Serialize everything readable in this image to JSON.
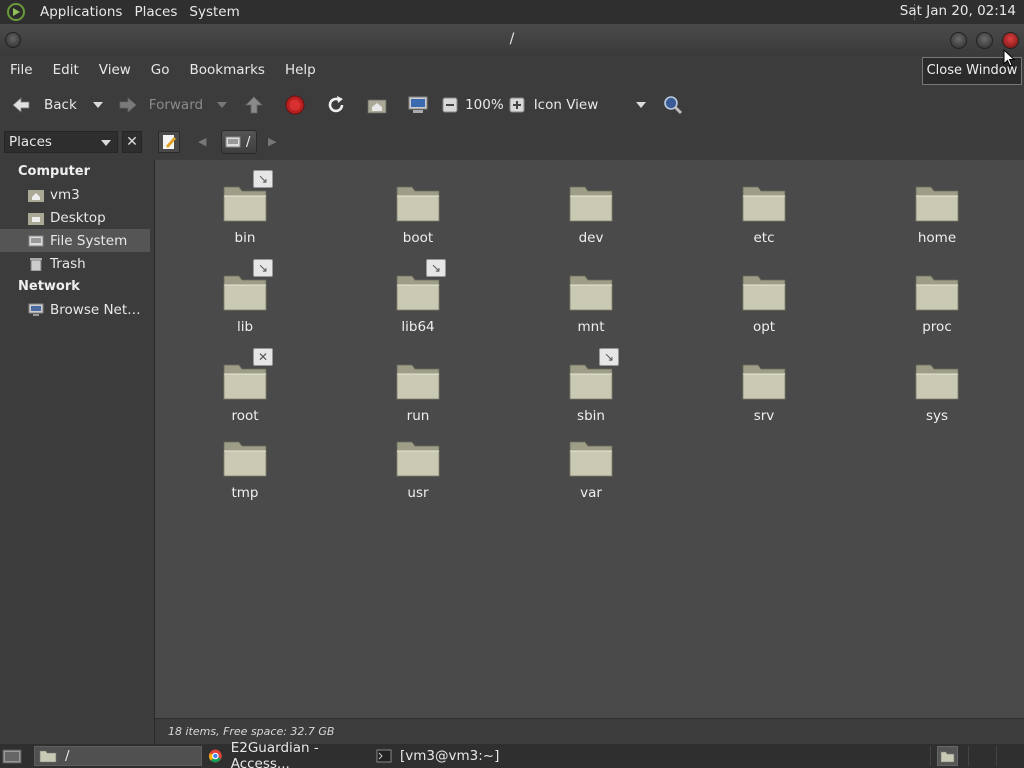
{
  "top_panel": {
    "menus": [
      "Applications",
      "Places",
      "System"
    ],
    "clock": "Sat Jan 20, 02:14"
  },
  "window": {
    "title": "/"
  },
  "tooltip": "Close Window",
  "menubar": [
    "File",
    "Edit",
    "View",
    "Go",
    "Bookmarks",
    "Help"
  ],
  "toolbar": {
    "back_label": "Back",
    "forward_label": "Forward",
    "zoom_level": "100%",
    "view_mode": "Icon View"
  },
  "location": {
    "sidebar_mode": "Places",
    "crumb_label": "/"
  },
  "sidebar": {
    "computer_heading": "Computer",
    "computer_items": [
      "vm3",
      "Desktop",
      "File System",
      "Trash"
    ],
    "network_heading": "Network",
    "network_items": [
      "Browse Net…"
    ],
    "selected": "File System"
  },
  "files": [
    {
      "name": "bin",
      "emblem": "symlink"
    },
    {
      "name": "boot",
      "emblem": ""
    },
    {
      "name": "dev",
      "emblem": ""
    },
    {
      "name": "etc",
      "emblem": ""
    },
    {
      "name": "home",
      "emblem": ""
    },
    {
      "name": "lib",
      "emblem": "symlink"
    },
    {
      "name": "lib64",
      "emblem": "symlink"
    },
    {
      "name": "mnt",
      "emblem": ""
    },
    {
      "name": "opt",
      "emblem": ""
    },
    {
      "name": "proc",
      "emblem": ""
    },
    {
      "name": "root",
      "emblem": "no-access"
    },
    {
      "name": "run",
      "emblem": ""
    },
    {
      "name": "sbin",
      "emblem": "symlink"
    },
    {
      "name": "srv",
      "emblem": ""
    },
    {
      "name": "sys",
      "emblem": ""
    },
    {
      "name": "tmp",
      "emblem": ""
    },
    {
      "name": "usr",
      "emblem": ""
    },
    {
      "name": "var",
      "emblem": ""
    }
  ],
  "status": "18 items, Free space: 32.7 GB",
  "taskbar": {
    "tasks": [
      "/",
      "E2Guardian - Access...",
      "[vm3@vm3:~]"
    ]
  },
  "colors": {
    "folder": "#c9c9b4",
    "close_button": "#d43030",
    "background": "#4a4a4a"
  }
}
